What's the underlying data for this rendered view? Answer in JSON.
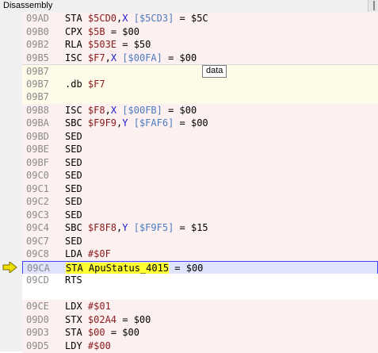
{
  "window": {
    "title": "Disassembly"
  },
  "tooltip": "data",
  "colors": {
    "code_bg": "#fcf0f0",
    "data_bg": "#fefbe8",
    "active_bg": "#dfe3fb",
    "active_border": "#4040ff",
    "highlight": "#ffff33"
  },
  "lines": [
    {
      "addr": "09AD",
      "type": "code",
      "parts": [
        [
          "op",
          "STA "
        ],
        [
          "num",
          "$5CD0"
        ],
        [
          "op",
          ","
        ],
        [
          "reg",
          "X"
        ],
        [
          "op",
          " "
        ],
        [
          "eff",
          "[$5CD3]"
        ],
        [
          "op",
          " = $5C"
        ]
      ]
    },
    {
      "addr": "09B0",
      "type": "code",
      "parts": [
        [
          "op",
          "CPX "
        ],
        [
          "num",
          "$5B"
        ],
        [
          "op",
          " = $00"
        ]
      ]
    },
    {
      "addr": "09B2",
      "type": "code",
      "parts": [
        [
          "op",
          "RLA "
        ],
        [
          "num",
          "$503E"
        ],
        [
          "op",
          " = $50"
        ]
      ]
    },
    {
      "addr": "09B5",
      "type": "code",
      "parts": [
        [
          "op",
          "ISC "
        ],
        [
          "num",
          "$F7"
        ],
        [
          "op",
          ","
        ],
        [
          "reg",
          "X"
        ],
        [
          "op",
          " "
        ],
        [
          "eff",
          "[$00FA]"
        ],
        [
          "op",
          " = $00"
        ]
      ]
    },
    {
      "addr": "09B7",
      "type": "data",
      "parts": []
    },
    {
      "addr": "09B7",
      "type": "data",
      "parts": [
        [
          "op",
          ".db "
        ],
        [
          "num",
          "$F7"
        ]
      ]
    },
    {
      "addr": "09B7",
      "type": "data",
      "parts": []
    },
    {
      "addr": "09B8",
      "type": "code",
      "parts": [
        [
          "op",
          "ISC "
        ],
        [
          "num",
          "$F8"
        ],
        [
          "op",
          ","
        ],
        [
          "reg",
          "X"
        ],
        [
          "op",
          " "
        ],
        [
          "eff",
          "[$00FB]"
        ],
        [
          "op",
          " = $00"
        ]
      ]
    },
    {
      "addr": "09BA",
      "type": "code",
      "parts": [
        [
          "op",
          "SBC "
        ],
        [
          "num",
          "$F9F9"
        ],
        [
          "op",
          ","
        ],
        [
          "reg",
          "Y"
        ],
        [
          "op",
          " "
        ],
        [
          "eff",
          "[$FAF6]"
        ],
        [
          "op",
          " = $00"
        ]
      ]
    },
    {
      "addr": "09BD",
      "type": "code",
      "parts": [
        [
          "op",
          "SED"
        ]
      ]
    },
    {
      "addr": "09BE",
      "type": "code",
      "parts": [
        [
          "op",
          "SED"
        ]
      ]
    },
    {
      "addr": "09BF",
      "type": "code",
      "parts": [
        [
          "op",
          "SED"
        ]
      ]
    },
    {
      "addr": "09C0",
      "type": "code",
      "parts": [
        [
          "op",
          "SED"
        ]
      ]
    },
    {
      "addr": "09C1",
      "type": "code",
      "parts": [
        [
          "op",
          "SED"
        ]
      ]
    },
    {
      "addr": "09C2",
      "type": "code",
      "parts": [
        [
          "op",
          "SED"
        ]
      ]
    },
    {
      "addr": "09C3",
      "type": "code",
      "parts": [
        [
          "op",
          "SED"
        ]
      ]
    },
    {
      "addr": "09C4",
      "type": "code",
      "parts": [
        [
          "op",
          "SBC "
        ],
        [
          "num",
          "$F8F8"
        ],
        [
          "op",
          ","
        ],
        [
          "reg",
          "Y"
        ],
        [
          "op",
          " "
        ],
        [
          "eff",
          "[$F9F5]"
        ],
        [
          "op",
          " = $15"
        ]
      ]
    },
    {
      "addr": "09C7",
      "type": "code",
      "parts": [
        [
          "op",
          "SED"
        ]
      ]
    },
    {
      "addr": "09C8",
      "type": "code",
      "parts": [
        [
          "op",
          "LDA "
        ],
        [
          "num",
          "#$0F"
        ]
      ]
    },
    {
      "addr": "09CA",
      "type": "active",
      "parts": [
        [
          "hl",
          "STA ApuStatus_4015"
        ],
        [
          "op",
          " = $00"
        ]
      ]
    },
    {
      "addr": "09CD",
      "type": "sep",
      "parts": [
        [
          "op",
          "RTS"
        ]
      ]
    },
    {
      "addr": "",
      "type": "sep",
      "parts": []
    },
    {
      "addr": "09CE",
      "type": "code",
      "parts": [
        [
          "op",
          "LDX "
        ],
        [
          "num",
          "#$01"
        ]
      ]
    },
    {
      "addr": "09D0",
      "type": "code",
      "parts": [
        [
          "op",
          "STX "
        ],
        [
          "num",
          "$02A4"
        ],
        [
          "op",
          " = $00"
        ]
      ]
    },
    {
      "addr": "09D3",
      "type": "code",
      "parts": [
        [
          "op",
          "STA "
        ],
        [
          "num",
          "$00"
        ],
        [
          "op",
          " = $00"
        ]
      ]
    },
    {
      "addr": "09D5",
      "type": "code",
      "parts": [
        [
          "op",
          "LDY "
        ],
        [
          "num",
          "#$00"
        ]
      ]
    }
  ]
}
